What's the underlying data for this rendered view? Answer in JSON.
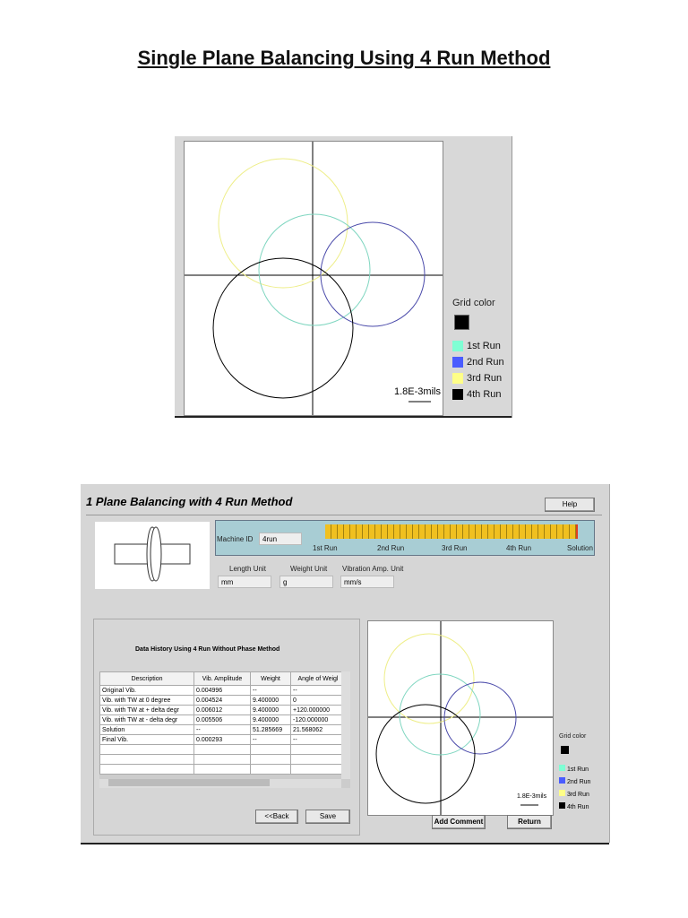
{
  "page_title": "Single Plane Balancing Using 4 Run Method",
  "plot": {
    "scale_label": "1.8E-3mils",
    "grid_color_label": "Grid color",
    "grid_color": "#000000",
    "legend": [
      {
        "label": "1st Run",
        "color": "#7fffd4"
      },
      {
        "label": "2nd Run",
        "color": "#4a5cff"
      },
      {
        "label": "3rd Run",
        "color": "#ffff88"
      },
      {
        "label": "4th Run",
        "color": "#000000"
      }
    ]
  },
  "app": {
    "title": "1 Plane Balancing with 4 Run Method",
    "help": "Help",
    "machine_id_label": "Machine ID",
    "machine_id": "4run",
    "progress": {
      "value_percent": 100,
      "steps": [
        "1st Run",
        "2nd Run",
        "3rd Run",
        "4th Run",
        "Solution"
      ]
    },
    "length_unit_label": "Length Unit",
    "length_unit": "mm",
    "weight_unit_label": "Weight Unit",
    "weight_unit": "g",
    "vib_unit_label": "Vibration Amp. Unit",
    "vib_unit": "mm/s",
    "table_title": "Data History Using 4 Run Without Phase Method",
    "columns": [
      "Description",
      "Vib. Amplitude",
      "Weight",
      "Angle of Weigl"
    ],
    "rows": [
      [
        "Original Vib.",
        "0.004996",
        "--",
        "--"
      ],
      [
        "Vib. with TW at 0 degree",
        "0.004524",
        "9.400000",
        "0"
      ],
      [
        "Vib. with TW at + delta degr",
        "0.006012",
        "9.400000",
        "+120.000000"
      ],
      [
        "Vib. with TW at -  delta degr",
        "0.005506",
        "9.400000",
        "-120.000000"
      ],
      [
        "Solution",
        "--",
        "51.285669",
        "21.568062"
      ],
      [
        "Final Vib.",
        "0.000293",
        "--",
        "--"
      ]
    ],
    "back": "<<Back",
    "save": "Save",
    "add_comment": "Add Comment",
    "return": "Return"
  }
}
